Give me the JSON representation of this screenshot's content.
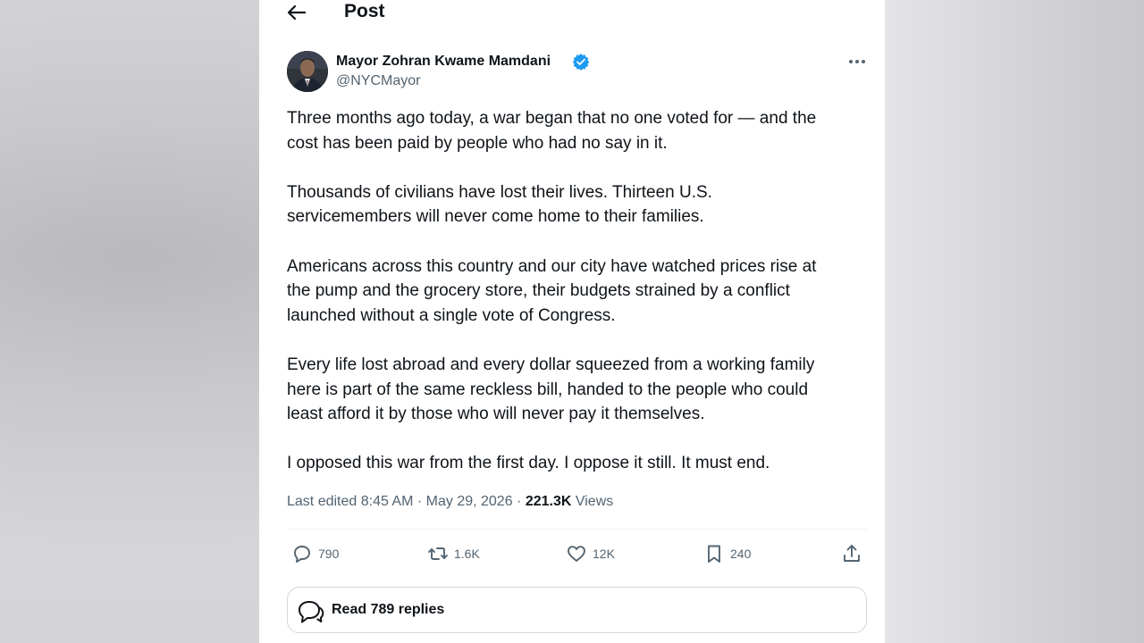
{
  "header": {
    "title": "Post",
    "back_icon": "arrow-left-icon"
  },
  "author": {
    "display_name": "Mayor Zohran Kwame Mamdani",
    "handle": "@NYCMayor",
    "verified": true,
    "verified_color": "#1d9bf0"
  },
  "post": {
    "paragraphs": [
      "Three months ago today, a war began that no one voted for — and the\ncost has been paid by people who had no say in it.",
      "Thousands of civilians have lost their lives. Thirteen U.S.\nservicemembers will never come home to their families.",
      "Americans across this country and our city have watched prices rise at\nthe pump and the grocery store, their budgets strained by a conflict\nlaunched without a single vote of Congress.",
      "Every life lost abroad and every dollar squeezed from a working family\nhere is part of the same reckless bill, handed to the people who could\nleast afford it by those who will never pay it themselves.",
      "I opposed this war from the first day. I oppose it still. It must end."
    ],
    "edited_prefix": "Last edited 8:45 AM · May 29, 2026 · ",
    "views_count": "221.3K",
    "views_label": " Views"
  },
  "actions": {
    "replies": "790",
    "reposts": "1.6K",
    "likes": "12K",
    "bookmarks": "240"
  },
  "read_replies": {
    "label": "Read 789 replies"
  },
  "colors": {
    "text": "#0f1419",
    "secondary": "#536471",
    "divider": "#eff3f4",
    "border": "#cfd9de"
  }
}
